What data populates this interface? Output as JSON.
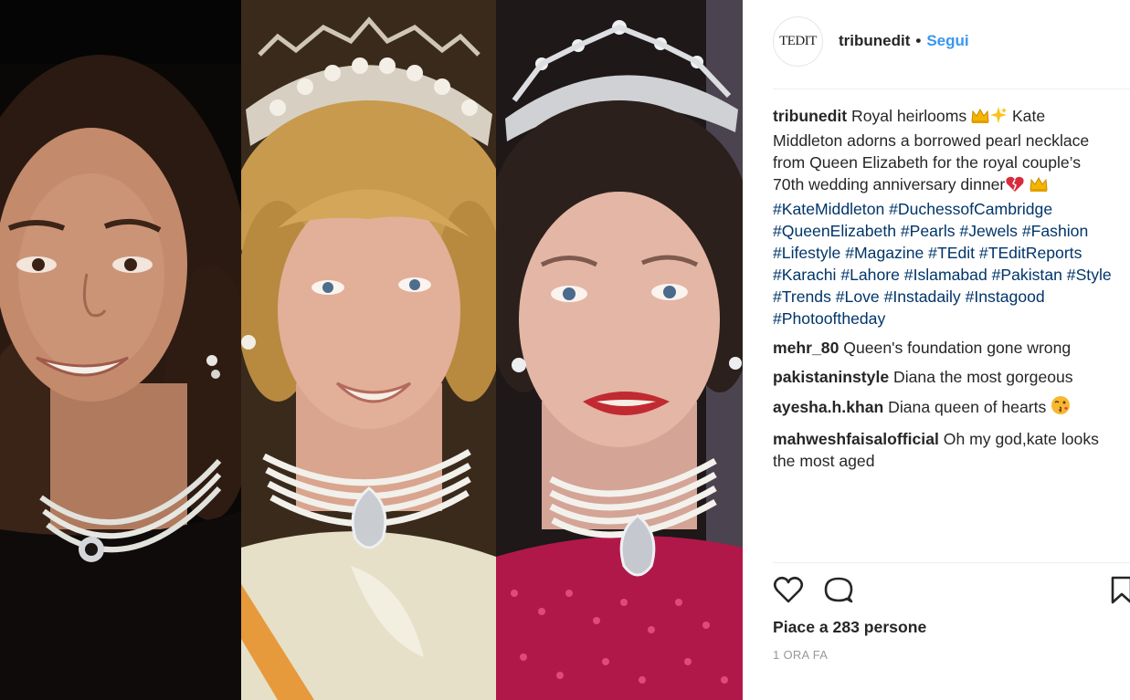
{
  "photo": {
    "alt": "Three-panel collage of women wearing the same pearl choker necklace"
  },
  "post": {
    "account": {
      "avatar_text": "TEDIT",
      "username": "tribunedit",
      "separator": "•",
      "follow_label": "Segui"
    },
    "caption": {
      "username": "tribunedit",
      "text_1": "Royal heirlooms",
      "text_2": "Kate",
      "line_2": "Middleton adorns a borrowed pearl necklace",
      "line_3": "from Queen Elizabeth for the royal couple’s",
      "line_4": "70th wedding anniversary dinner",
      "hashtags": [
        "#KateMiddleton #DuchessofCambridge",
        "#QueenElizabeth #Pearls #Jewels #Fashion",
        "#Lifestyle #Magazine #TEdit #TEditReports",
        "#Karachi #Lahore #Islamabad #Pakistan #Style",
        "#Trends #Love #Instadaily #Instagood",
        "#Photooftheday"
      ]
    },
    "comments": [
      {
        "username": "mehr_80",
        "text": "Queen's foundation gone wrong"
      },
      {
        "username": "pakistaninstyle",
        "text": "Diana the most gorgeous"
      },
      {
        "username": "ayesha.h.khan",
        "text": "Diana queen of hearts"
      },
      {
        "username": "mahweshfaisalofficial",
        "text": "Oh my god,kate looks",
        "text_cont": "the most aged"
      }
    ],
    "actions": {
      "like_icon": "heart-outline-icon",
      "comment_icon": "speech-bubble-icon",
      "save_icon": "bookmark-icon"
    },
    "likes_text": "Piace a 283 persone",
    "timestamp": "1 ORA FA"
  },
  "colors": {
    "link_blue": "#3897f0",
    "hashtag": "#003569",
    "text": "#262626",
    "muted": "#999999",
    "divider": "#efefef"
  }
}
